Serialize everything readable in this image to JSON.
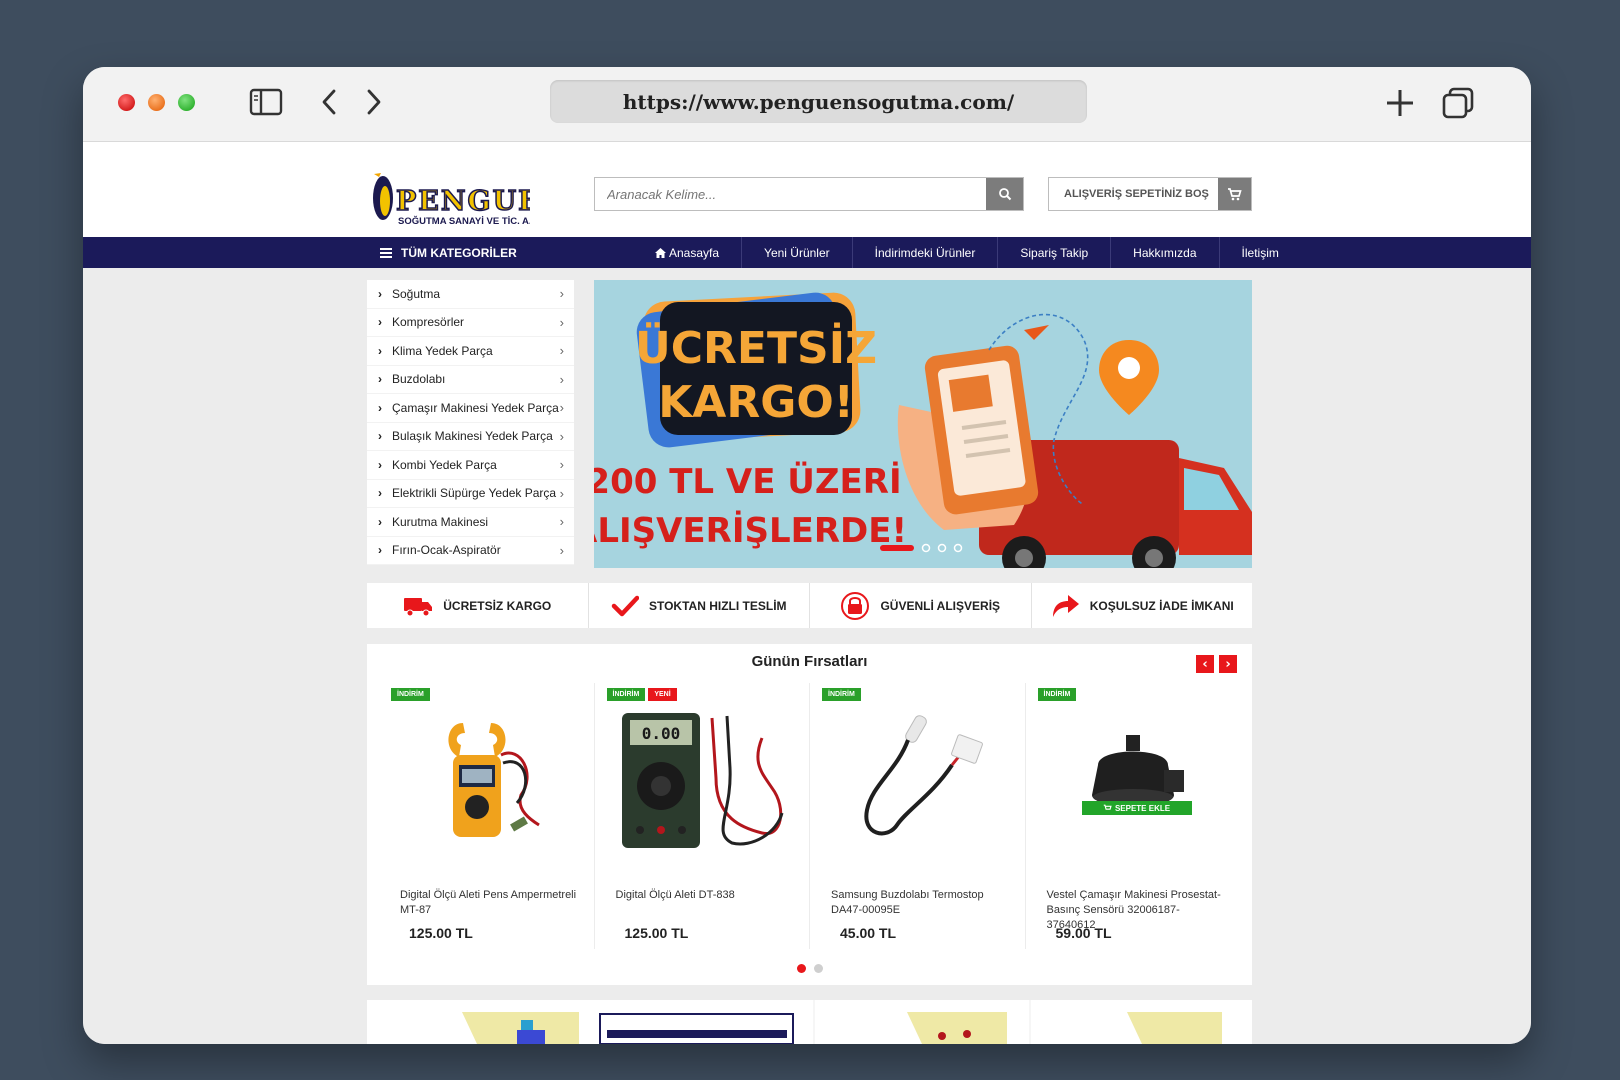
{
  "browser": {
    "url": "https://www.penguensogutma.com/"
  },
  "header": {
    "logo_text": "PENGUEN",
    "logo_subtext": "SOĞUTMA SANAYİ VE TİC. A.Ş.",
    "search_placeholder": "Aranacak Kelime...",
    "cart_label": "ALIŞVERİŞ SEPETİNİZ BOŞ"
  },
  "nav": {
    "all_categories": "TÜM KATEGORİLER",
    "links": [
      "Anasayfa",
      "Yeni Ürünler",
      "İndirimdeki Ürünler",
      "Sipariş Takip",
      "Hakkımızda",
      "İletişim"
    ]
  },
  "categories": [
    "Soğutma",
    "Kompresörler",
    "Klima Yedek Parça",
    "Buzdolabı",
    "Çamaşır Makinesi Yedek Parça",
    "Bulaşık Makinesi Yedek Parça",
    "Kombi Yedek Parça",
    "Elektrikli Süpürge Yedek Parça",
    "Kurutma Makinesi",
    "Fırın-Ocak-Aspiratör"
  ],
  "banner": {
    "headline_line1": "ÜCRETSİZ",
    "headline_line2": "KARGO!",
    "subline1": "200 TL VE ÜZERİ",
    "subline2": "ALIŞVERİŞLERDE!",
    "slides": 4,
    "active_slide": 1
  },
  "features": [
    "ÜCRETSİZ KARGO",
    "STOKTAN HIZLI TESLİM",
    "GÜVENLİ ALIŞVERİŞ",
    "KOŞULSUZ İADE İMKANI"
  ],
  "deals": {
    "title": "Günün Fırsatları",
    "products": [
      {
        "name": "Digital Ölçü Aleti Pens Ampermetreli MT-87",
        "price": "125.00 TL",
        "badges": [
          "İNDİRİM"
        ]
      },
      {
        "name": "Digital Ölçü Aleti DT-838",
        "price": "125.00 TL",
        "badges": [
          "İNDİRİM",
          "YENİ"
        ],
        "display": "0.00"
      },
      {
        "name": "Samsung Buzdolabı Termostop DA47-00095E",
        "price": "45.00 TL",
        "badges": [
          "İNDİRİM"
        ]
      },
      {
        "name": "Vestel Çamaşır Makinesi Prosestat-Basınç Sensörü 32006187-37640612",
        "price": "59.00 TL",
        "badges": [
          "İNDİRİM"
        ],
        "add_to_cart": "SEPETE EKLE"
      }
    ],
    "pages": 2,
    "active_page": 1
  },
  "colors": {
    "nav_bg": "#1b1a5a",
    "accent_red": "#e8171b",
    "badge_green": "#2aa02a",
    "banner_bg": "#a6d4df"
  }
}
